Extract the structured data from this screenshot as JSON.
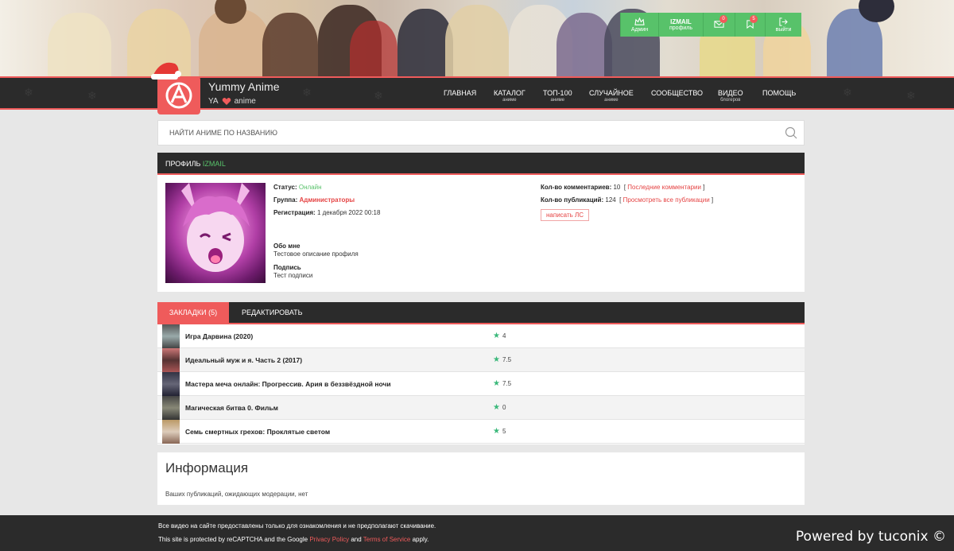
{
  "site": {
    "name": "Yummy Anime",
    "sub_left": "YA",
    "sub_right": "anime",
    "accent": "#ef5b5b",
    "green": "#58c26a"
  },
  "user_panel": {
    "admin_label": "Админ",
    "username": "IZMAIL",
    "profile_label": "профиль",
    "messages_count": "0",
    "bookmarks_count": "5",
    "logout_label": "выйти"
  },
  "nav": [
    {
      "label": "ГЛАВНАЯ",
      "sub": ""
    },
    {
      "label": "КАТАЛОГ",
      "sub": "аниме"
    },
    {
      "label": "ТОП-100",
      "sub": "аниме"
    },
    {
      "label": "СЛУЧАЙНОЕ",
      "sub": "аниме"
    },
    {
      "label": "СООБЩЕСТВО",
      "sub": ""
    },
    {
      "label": "ВИДЕО",
      "sub": "блогеров"
    },
    {
      "label": "ПОМОЩЬ",
      "sub": ""
    }
  ],
  "search": {
    "placeholder": "НАЙТИ АНИМЕ ПО НАЗВАНИЮ"
  },
  "profile": {
    "title_prefix": "ПРОФИЛЬ",
    "username": "IZMAIL",
    "status_label": "Статус:",
    "status_value": "Онлайн",
    "group_label": "Группа:",
    "group_value": "Администраторы",
    "reg_label": "Регистрация:",
    "reg_value": "1 декабря 2022 00:18",
    "about_label": "Обо мне",
    "about_value": "Тестовое описание профиля",
    "sign_label": "Подпись",
    "sign_value": "Тест подписи",
    "comments_label": "Кол-во комментариев:",
    "comments_value": "10",
    "comments_link": "Последние комментарии",
    "pubs_label": "Кол-во публикаций:",
    "pubs_value": "124",
    "pubs_link": "Просмотреть все публикации",
    "pm_button": "написать ЛС"
  },
  "tabs": {
    "bookmarks": "ЗАКЛАДКИ (5)",
    "edit": "РЕДАКТИРОВАТЬ"
  },
  "bookmarks": [
    {
      "title": "Игра Дарвина (2020)",
      "rating": "4"
    },
    {
      "title": "Идеальный муж и я. Часть 2 (2017)",
      "rating": "7.5"
    },
    {
      "title": "Мастера меча онлайн: Прогрессив. Ария в беззвёздной ночи",
      "rating": "7.5"
    },
    {
      "title": "Магическая битва 0. Фильм",
      "rating": "0"
    },
    {
      "title": "Семь смертных грехов: Проклятые светом",
      "rating": "5"
    }
  ],
  "info": {
    "title": "Информация",
    "text": "Ваших публикаций, ожидающих модерации, нет"
  },
  "footer": {
    "line1": "Все видео на сайте предоставлены только для ознакомления и не предполагают скачивание.",
    "line2_a": "This site is protected by reCAPTCHA and the Google",
    "privacy": "Privacy Policy",
    "line2_and": "and",
    "terms": "Terms of Service",
    "line2_b": "apply.",
    "powered": "Powered by tuconix ©"
  }
}
